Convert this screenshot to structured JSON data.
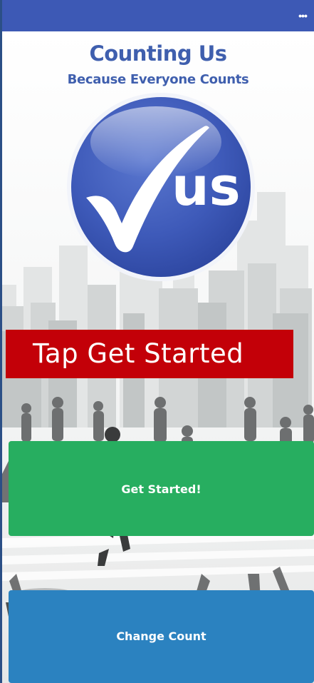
{
  "header": {
    "menu_icon": "more-dots-icon"
  },
  "app": {
    "title": "Counting Us",
    "tagline": "Because Everyone Counts"
  },
  "logo": {
    "text": "us",
    "icon": "checkmark-icon"
  },
  "banner": {
    "text": "Tap Get Started"
  },
  "buttons": {
    "get_started": "Get Started!",
    "change_count": "Change Count"
  },
  "colors": {
    "topbar": "#3d59b5",
    "brand_text": "#3f5fae",
    "banner": "#c30008",
    "get_started": "#27ae60",
    "change_count": "#2b82c0"
  }
}
